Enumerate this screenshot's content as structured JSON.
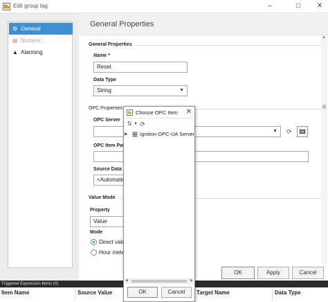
{
  "window": {
    "title": "Edit group tag",
    "controls": [
      "minimize-icon",
      "maximize-icon",
      "close-icon"
    ]
  },
  "sidebar": {
    "items": [
      {
        "label": "General",
        "icon": "gear-icon",
        "selected": true
      },
      {
        "label": "Numeric",
        "icon": "numeric-icon",
        "disabled": true
      },
      {
        "label": "Alarming",
        "icon": "bell-icon"
      }
    ]
  },
  "header": {
    "title": "General Properties"
  },
  "general": {
    "section": "General Properties",
    "name_label": "Name *",
    "name_value": "Reset",
    "datatype_label": "Data Type",
    "datatype_value": "String"
  },
  "opc": {
    "section": "OPC Properties",
    "server_label": "OPC Server",
    "server_value": "",
    "itempath_label": "OPC Item Path",
    "itempath_value": "",
    "sourcedata_label": "Source Data",
    "sourcedata_value": "<Automatic>"
  },
  "valuemode": {
    "section": "Value Mode",
    "property_label": "Property",
    "property_value": "Value",
    "mode_label": "Mode",
    "mode_options": [
      "Direct value",
      "Hour meter"
    ],
    "mode_selected": 0
  },
  "buttons": {
    "ok": "OK",
    "apply": "Apply",
    "cancel": "Cancel"
  },
  "bottom": {
    "band_text": "Triggered Expression Items (0)",
    "columns": [
      "Item Name",
      "Source Value",
      "Target Name",
      "Data Type"
    ]
  },
  "dialog": {
    "title": "Choose OPC Item",
    "tree_root": "Ignition OPC-UA Server",
    "ok": "OK",
    "cancel": "Cancel"
  },
  "colors": {
    "accent": "#3f8fd6",
    "band": "#2b2b2b",
    "header_bg": "#f1f1f1"
  }
}
